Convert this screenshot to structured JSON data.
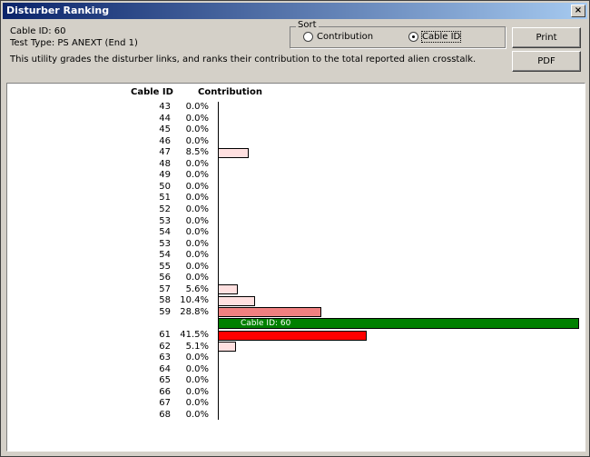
{
  "window": {
    "title": "Disturber Ranking",
    "close_glyph": "×"
  },
  "info": {
    "cable_id": "Cable ID: 60",
    "test_type": "Test Type: PS ANEXT (End 1)",
    "description": "This utility grades the disturber links, and ranks their contribution to the total reported alien crosstalk."
  },
  "sort": {
    "legend": "Sort",
    "options": [
      {
        "label": "Contribution",
        "selected": false
      },
      {
        "label": "Cable ID",
        "selected": true
      }
    ]
  },
  "buttons": {
    "print": "Print",
    "pdf": "PDF"
  },
  "table": {
    "header_id": "Cable ID",
    "header_contribution": "Contribution"
  },
  "colors": {
    "low": "#ffe0e0",
    "mid": "#f08080",
    "high": "#ff0000",
    "selected": "#008000"
  },
  "chart_data": {
    "type": "bar",
    "orientation": "horizontal",
    "categories": [
      "43",
      "44",
      "45",
      "46",
      "47",
      "48",
      "49",
      "50",
      "51",
      "52",
      "53",
      "54",
      "53",
      "54",
      "55",
      "56",
      "57",
      "58",
      "59",
      "60",
      "61",
      "62",
      "63",
      "64",
      "65",
      "66",
      "67",
      "68"
    ],
    "values": [
      0.0,
      0.0,
      0.0,
      0.0,
      8.5,
      0.0,
      0.0,
      0.0,
      0.0,
      0.0,
      0.0,
      0.0,
      0.0,
      0.0,
      0.0,
      0.0,
      5.6,
      10.4,
      28.8,
      null,
      41.5,
      5.1,
      0.0,
      0.0,
      0.0,
      0.0,
      0.0,
      0.0
    ],
    "labels": [
      "0.0%",
      "0.0%",
      "0.0%",
      "0.0%",
      "8.5%",
      "0.0%",
      "0.0%",
      "0.0%",
      "0.0%",
      "0.0%",
      "0.0%",
      "0.0%",
      "0.0%",
      "0.0%",
      "0.0%",
      "0.0%",
      "5.6%",
      "10.4%",
      "28.8%",
      "",
      "41.5%",
      "5.1%",
      "0.0%",
      "0.0%",
      "0.0%",
      "0.0%",
      "0.0%",
      "0.0%"
    ],
    "selected_label": "Cable ID: 60",
    "xlim": [
      0,
      100
    ]
  }
}
